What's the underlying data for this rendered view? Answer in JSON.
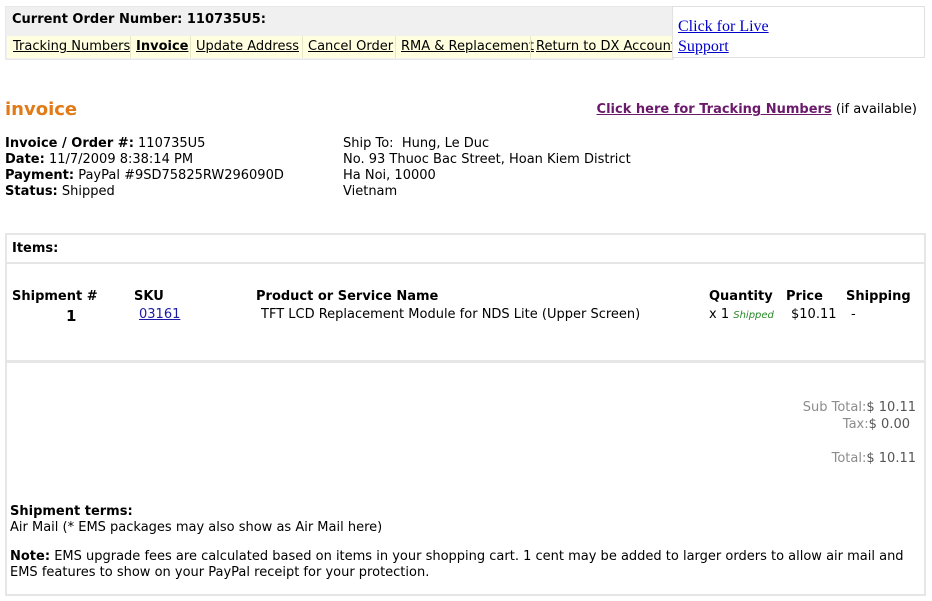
{
  "header": {
    "order_label": "Current Order Number: 110735U5:",
    "nav": [
      {
        "label": "Tracking Numbers",
        "active": false
      },
      {
        "label": "Invoice",
        "active": true
      },
      {
        "label": "Update Address",
        "active": false
      },
      {
        "label": "Cancel Order",
        "active": false
      },
      {
        "label": "RMA & Replacement",
        "active": false
      },
      {
        "label": "Return to DX Account",
        "active": false
      }
    ],
    "live_support": "Click for Live Support"
  },
  "invoice": {
    "heading": "invoice",
    "tracking_link": "Click here for Tracking Numbers",
    "tracking_suffix": "(if available)",
    "order_no_label": "Invoice / Order #:",
    "order_no": "110735U5",
    "date_label": "Date:",
    "date": "11/7/2009 8:38:14 PM",
    "payment_label": "Payment:",
    "payment": "PayPal #9SD75825RW296090D",
    "status_label": "Status:",
    "status": "Shipped",
    "ship_to_label": "Ship To:",
    "ship_to_name": "Hung, Le Duc",
    "ship_to_line1": "No. 93 Thuoc Bac Street, Hoan Kiem District",
    "ship_to_line2": "Ha Noi, 10000",
    "ship_to_country": "Vietnam"
  },
  "items": {
    "title": "Items:",
    "columns": {
      "shipment": "Shipment #",
      "sku": "SKU",
      "name": "Product or Service Name",
      "quantity": "Quantity",
      "price": "Price",
      "shipping": "Shipping"
    },
    "rows": [
      {
        "shipment": "1",
        "sku": "03161",
        "name": "TFT LCD Replacement Module for NDS Lite (Upper Screen)",
        "quantity": "x 1",
        "qty_status": "Shipped",
        "price": "$10.11",
        "shipping": "-"
      }
    ]
  },
  "totals": {
    "subtotal_label": "Sub Total:",
    "subtotal": "$ 10.11",
    "tax_label": "Tax:",
    "tax": "$ 0.00",
    "total_label": "Total:",
    "total": "$ 10.11"
  },
  "terms": {
    "heading": "Shipment terms:",
    "text": "Air Mail (* EMS packages may also show as Air Mail here)",
    "note_label": "Note:",
    "note_text": "EMS upgrade fees are calculated based on items in your shopping cart. 1 cent may be added to larger orders to allow air mail and EMS features to show on your PayPal receipt for your protection."
  }
}
